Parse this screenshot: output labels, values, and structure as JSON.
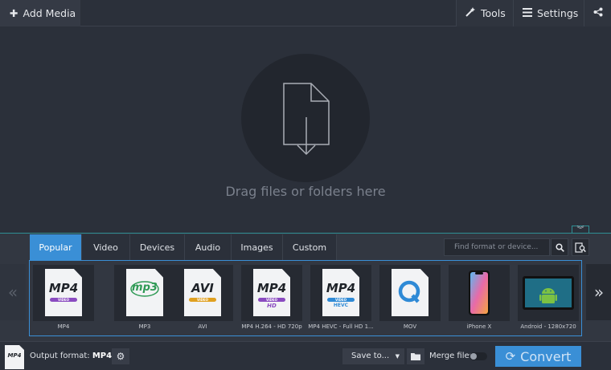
{
  "toolbar": {
    "add_media_label": "Add Media",
    "tools_label": "Tools",
    "settings_label": "Settings"
  },
  "dropzone": {
    "text": "Drag files or folders here"
  },
  "formats": {
    "tabs": [
      {
        "label": "Popular",
        "active": true
      },
      {
        "label": "Video",
        "active": false
      },
      {
        "label": "Devices",
        "active": false
      },
      {
        "label": "Audio",
        "active": false
      },
      {
        "label": "Images",
        "active": false
      },
      {
        "label": "Custom",
        "active": false
      }
    ],
    "search_placeholder": "Find format or device...",
    "items": [
      {
        "icon": "MP4",
        "band": "VIDEO",
        "sub": "",
        "caption": "MP4"
      },
      {
        "icon": "mp3",
        "band": "",
        "sub": "",
        "caption": "MP3"
      },
      {
        "icon": "AVI",
        "band": "VIDEO",
        "sub": "",
        "caption": "AVI"
      },
      {
        "icon": "MP4",
        "band": "VIDEO",
        "sub": "HD",
        "caption": "MP4 H.264 - HD 720p"
      },
      {
        "icon": "MP4",
        "band": "VIDEO",
        "sub": "HEVC",
        "caption": "MP4 HEVC - Full HD 1..."
      },
      {
        "icon": "quicktime-icon",
        "band": "",
        "sub": "",
        "caption": "MOV"
      },
      {
        "icon": "iphone-icon",
        "band": "",
        "sub": "",
        "caption": "iPhone X"
      },
      {
        "icon": "android-tablet-icon",
        "band": "",
        "sub": "",
        "caption": "Android - 1280x720"
      }
    ]
  },
  "bottom": {
    "output_format_label": "Output format:",
    "output_format_value": "MP4",
    "output_icon_text": "MP4",
    "save_to_label": "Save to...",
    "merge_label": "Merge files",
    "merge_on": false,
    "convert_label": "Convert"
  },
  "colors": {
    "accent": "#3a8fd6",
    "background": "#2b303a",
    "panel": "#323741",
    "teal_divider": "#2f8f94"
  }
}
